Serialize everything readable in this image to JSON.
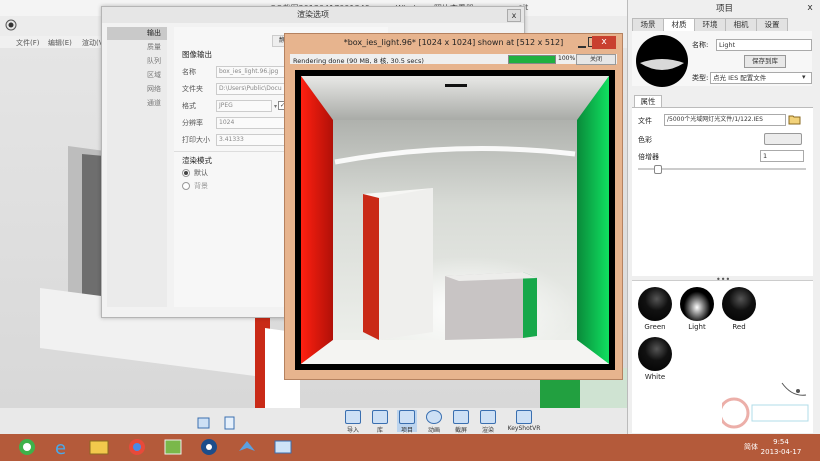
{
  "viewer": {
    "title": "QQ截图20130417091349.png - Windows 照片查看器",
    "title_right": "oit",
    "menu": [
      "文件(F)",
      "编辑(E)",
      "渲动(V)"
    ]
  },
  "toolbar": {
    "items": [
      {
        "label": "导入",
        "icon": "import-icon"
      },
      {
        "label": "库",
        "icon": "library-icon"
      },
      {
        "label": "项目",
        "icon": "project-icon"
      },
      {
        "label": "动画",
        "icon": "animation-icon"
      },
      {
        "label": "截屏",
        "icon": "screenshot-icon"
      },
      {
        "label": "渲染",
        "icon": "render-icon"
      },
      {
        "label": "KeyShotVR",
        "icon": "keyshotvr-icon"
      }
    ]
  },
  "dialog": {
    "title": "渲染选项",
    "close": "x",
    "nav": [
      "输出",
      "质量",
      "队列",
      "区域",
      "网络",
      "通道"
    ],
    "section_image": "图像输出",
    "fields": [
      {
        "label": "名称",
        "value": "box_ies_light.96.jpg"
      },
      {
        "label": "文件夹",
        "value": "D:\\Users\\Public\\Docu"
      },
      {
        "label": "格式",
        "value": "JPEG"
      },
      {
        "label": "分辨率",
        "value": "1024"
      },
      {
        "label": "打印大小",
        "value": "3.41333"
      }
    ],
    "section_mode": "渲染模式",
    "modes": [
      "默认",
      "背景"
    ],
    "tab_stub": "静"
  },
  "render_window": {
    "title": "*box_ies_light.96* [1024 x 1024] shown at [512 x 512]",
    "status": "Rendering done (90 MB, 8 核, 30.5 secs)",
    "progress_percent": 100,
    "progress_label": "100%",
    "stop_button": "关闭",
    "close": "x"
  },
  "project": {
    "title": "项目",
    "close": "x",
    "tabs": [
      "场景",
      "材质",
      "环境",
      "相机",
      "设置"
    ],
    "selected_tab": 1,
    "name_label": "名称:",
    "name_value": "Light",
    "save_button": "保存到库",
    "type_label": "类型:",
    "type_value": "点光 IES 配置文件",
    "attr_tab": "属性",
    "file_label": "文件",
    "file_value": "/5000个光域网灯光文件/1/122.IES",
    "color_label": "色彩",
    "multiplier_label": "倍增器",
    "multiplier_value": "1",
    "library": [
      "Green",
      "Light",
      "Red",
      "White"
    ]
  },
  "taskbar": {
    "ime": "简体",
    "time": "9:54",
    "date": "2013-04-17"
  },
  "colors": {
    "taskbar": "#b45a3a",
    "render_frame": "#e7b48e",
    "progress": "#20b040",
    "close_red": "#c9402f"
  }
}
